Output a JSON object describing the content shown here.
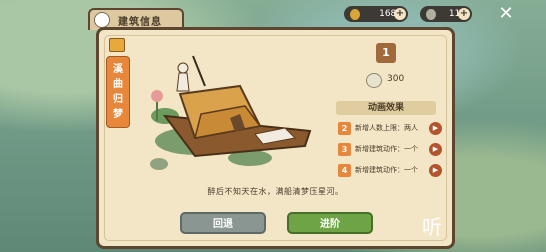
{
  "header": {
    "title": "建筑信息"
  },
  "resources": [
    {
      "icon": "gold-coin-icon",
      "value": "1686",
      "color": "#d9a636"
    },
    {
      "icon": "copper-coin-icon",
      "value": "114",
      "color": "#b0b0a0"
    }
  ],
  "building": {
    "name": "溪曲归梦",
    "level": "1",
    "cost": "300"
  },
  "animation_effects": {
    "title": "动画效果",
    "items": [
      {
        "num": "2",
        "text": "新增人数上限：两人"
      },
      {
        "num": "3",
        "text": "新增建筑动作：一个"
      },
      {
        "num": "4",
        "text": "新增建筑动作：一个"
      }
    ]
  },
  "description": "醉后不知天在水，满船清梦压星河。",
  "buttons": {
    "back": "回退",
    "next": "进阶"
  },
  "listen_icon_label": "听"
}
